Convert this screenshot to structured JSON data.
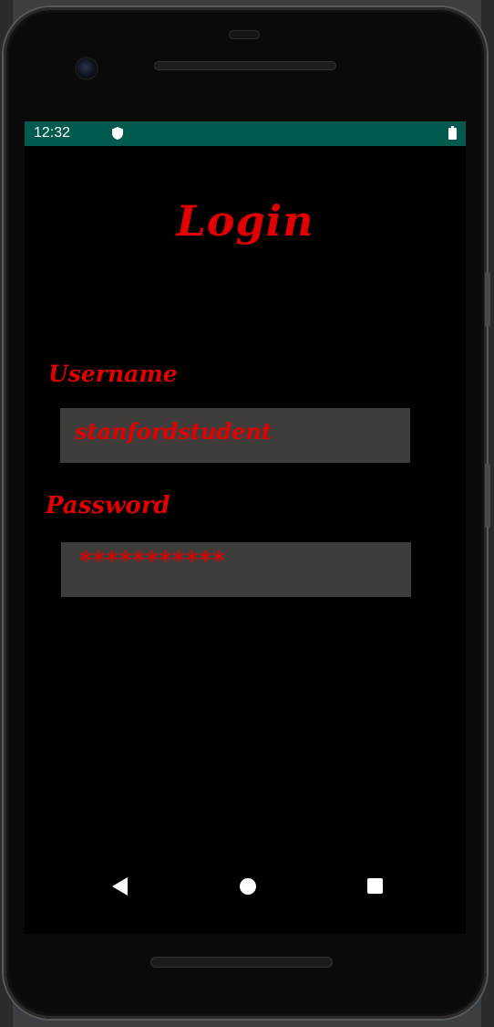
{
  "status_bar": {
    "time": "12:32",
    "icons": [
      "shield-icon",
      "battery-icon"
    ],
    "background_color": "#005b4e"
  },
  "login": {
    "title": "Login",
    "username_label": "Username",
    "username_value": "stanfordstudent",
    "password_label": "Password",
    "password_value": "***********"
  },
  "nav_bar": {
    "icons": [
      "back-icon",
      "home-icon",
      "recents-icon"
    ]
  },
  "colors": {
    "accent": "#e00000",
    "field_background": "#3e3d3b",
    "screen_background": "#000000"
  }
}
